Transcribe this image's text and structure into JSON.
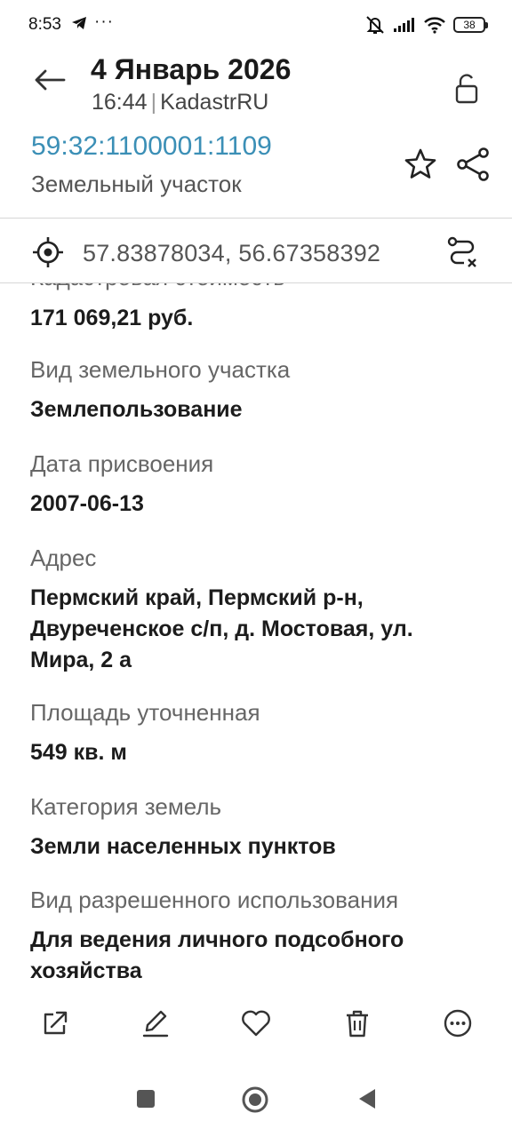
{
  "status_bar": {
    "time": "8:53",
    "overflow_dots": "···",
    "battery": "38",
    "icons": [
      "telegram-icon",
      "mute-icon",
      "signal-icon",
      "wifi-icon",
      "battery-icon"
    ]
  },
  "header": {
    "title": "4 Январь 2026",
    "time": "16:44",
    "separator": "|",
    "source": "KadastrRU",
    "cadastral_number": "59:32:1100001:1109",
    "object_type": "Земельный участок",
    "icons": [
      "back-arrow-icon",
      "unlock-icon",
      "star-icon",
      "share-icon"
    ]
  },
  "coord_bar": {
    "coordinates": "57.83878034, 56.67358392",
    "icons": [
      "target-icon",
      "route-icon"
    ]
  },
  "content": {
    "partial_label": "Кадастровая стоимость",
    "first_value": "171 069,21 руб.",
    "fields": [
      {
        "label": "Вид земельного участка",
        "value": "Землепользование"
      },
      {
        "label": "Дата присвоения",
        "value": "2007-06-13"
      },
      {
        "label": "Адрес",
        "value_lines": [
          "Пермский край, Пермский р-н,",
          "Двуреченское с/п, д. Мостовая, ул.",
          "Мира, 2 а"
        ]
      },
      {
        "label": "Площадь уточненная",
        "value": "549 кв. м"
      },
      {
        "label": "Категория земель",
        "value": "Земли населенных пунктов"
      },
      {
        "label": "Вид разрешенного использования",
        "value_lines": [
          "Для ведения личного подсобного",
          "хозяйства"
        ]
      }
    ]
  },
  "toolbar": {
    "icons": [
      "open-external-icon",
      "edit-pencil-icon",
      "heart-icon",
      "trash-icon",
      "more-icon"
    ]
  },
  "nav": {
    "icons": [
      "recents-square-icon",
      "home-circle-icon",
      "back-triangle-icon"
    ]
  },
  "colors": {
    "accent": "#3b8fb6",
    "text_primary": "#1c1c1c",
    "text_secondary": "#666666",
    "divider": "#d6d6d6"
  }
}
